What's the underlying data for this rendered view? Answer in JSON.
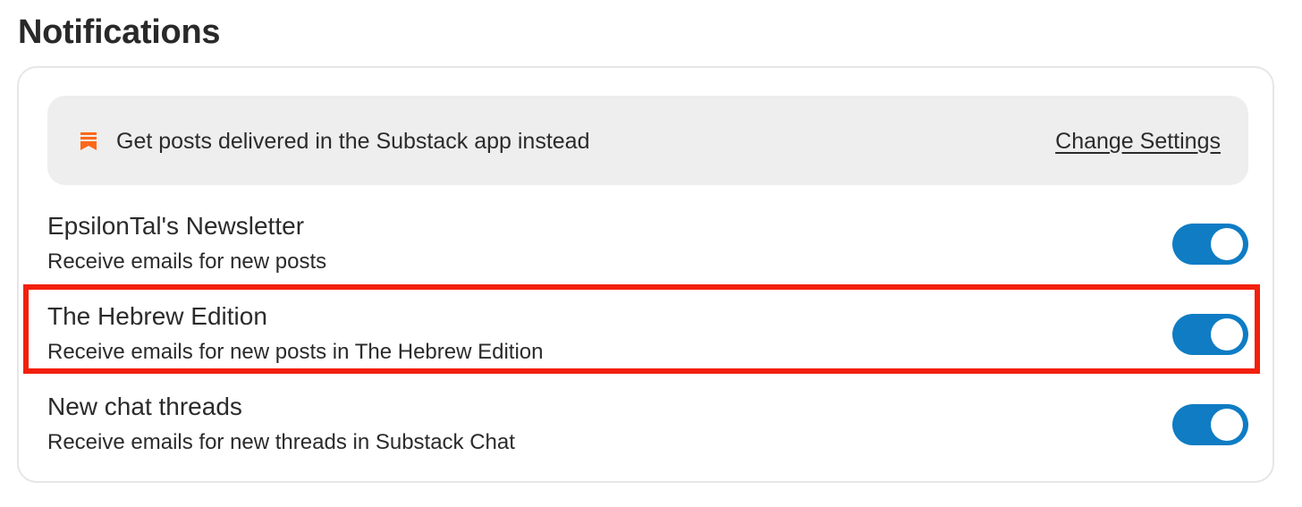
{
  "page": {
    "title": "Notifications"
  },
  "banner": {
    "icon": "substack-bookmark-icon",
    "icon_color": "#ff6719",
    "text": "Get posts delivered in the Substack app instead",
    "link_label": "Change Settings"
  },
  "settings": [
    {
      "title": "EpsilonTal's Newsletter",
      "subtitle": "Receive emails for new posts",
      "enabled": true
    },
    {
      "title": "The Hebrew Edition",
      "subtitle": "Receive emails for new posts in The Hebrew Edition",
      "enabled": true,
      "highlighted": true
    },
    {
      "title": "New chat threads",
      "subtitle": "Receive emails for new threads in Substack Chat",
      "enabled": true
    }
  ],
  "colors": {
    "toggle_on": "#0f7cc4",
    "highlight_border": "#f2200c",
    "banner_bg": "#eeeeee",
    "card_border": "#e6e6e6"
  }
}
